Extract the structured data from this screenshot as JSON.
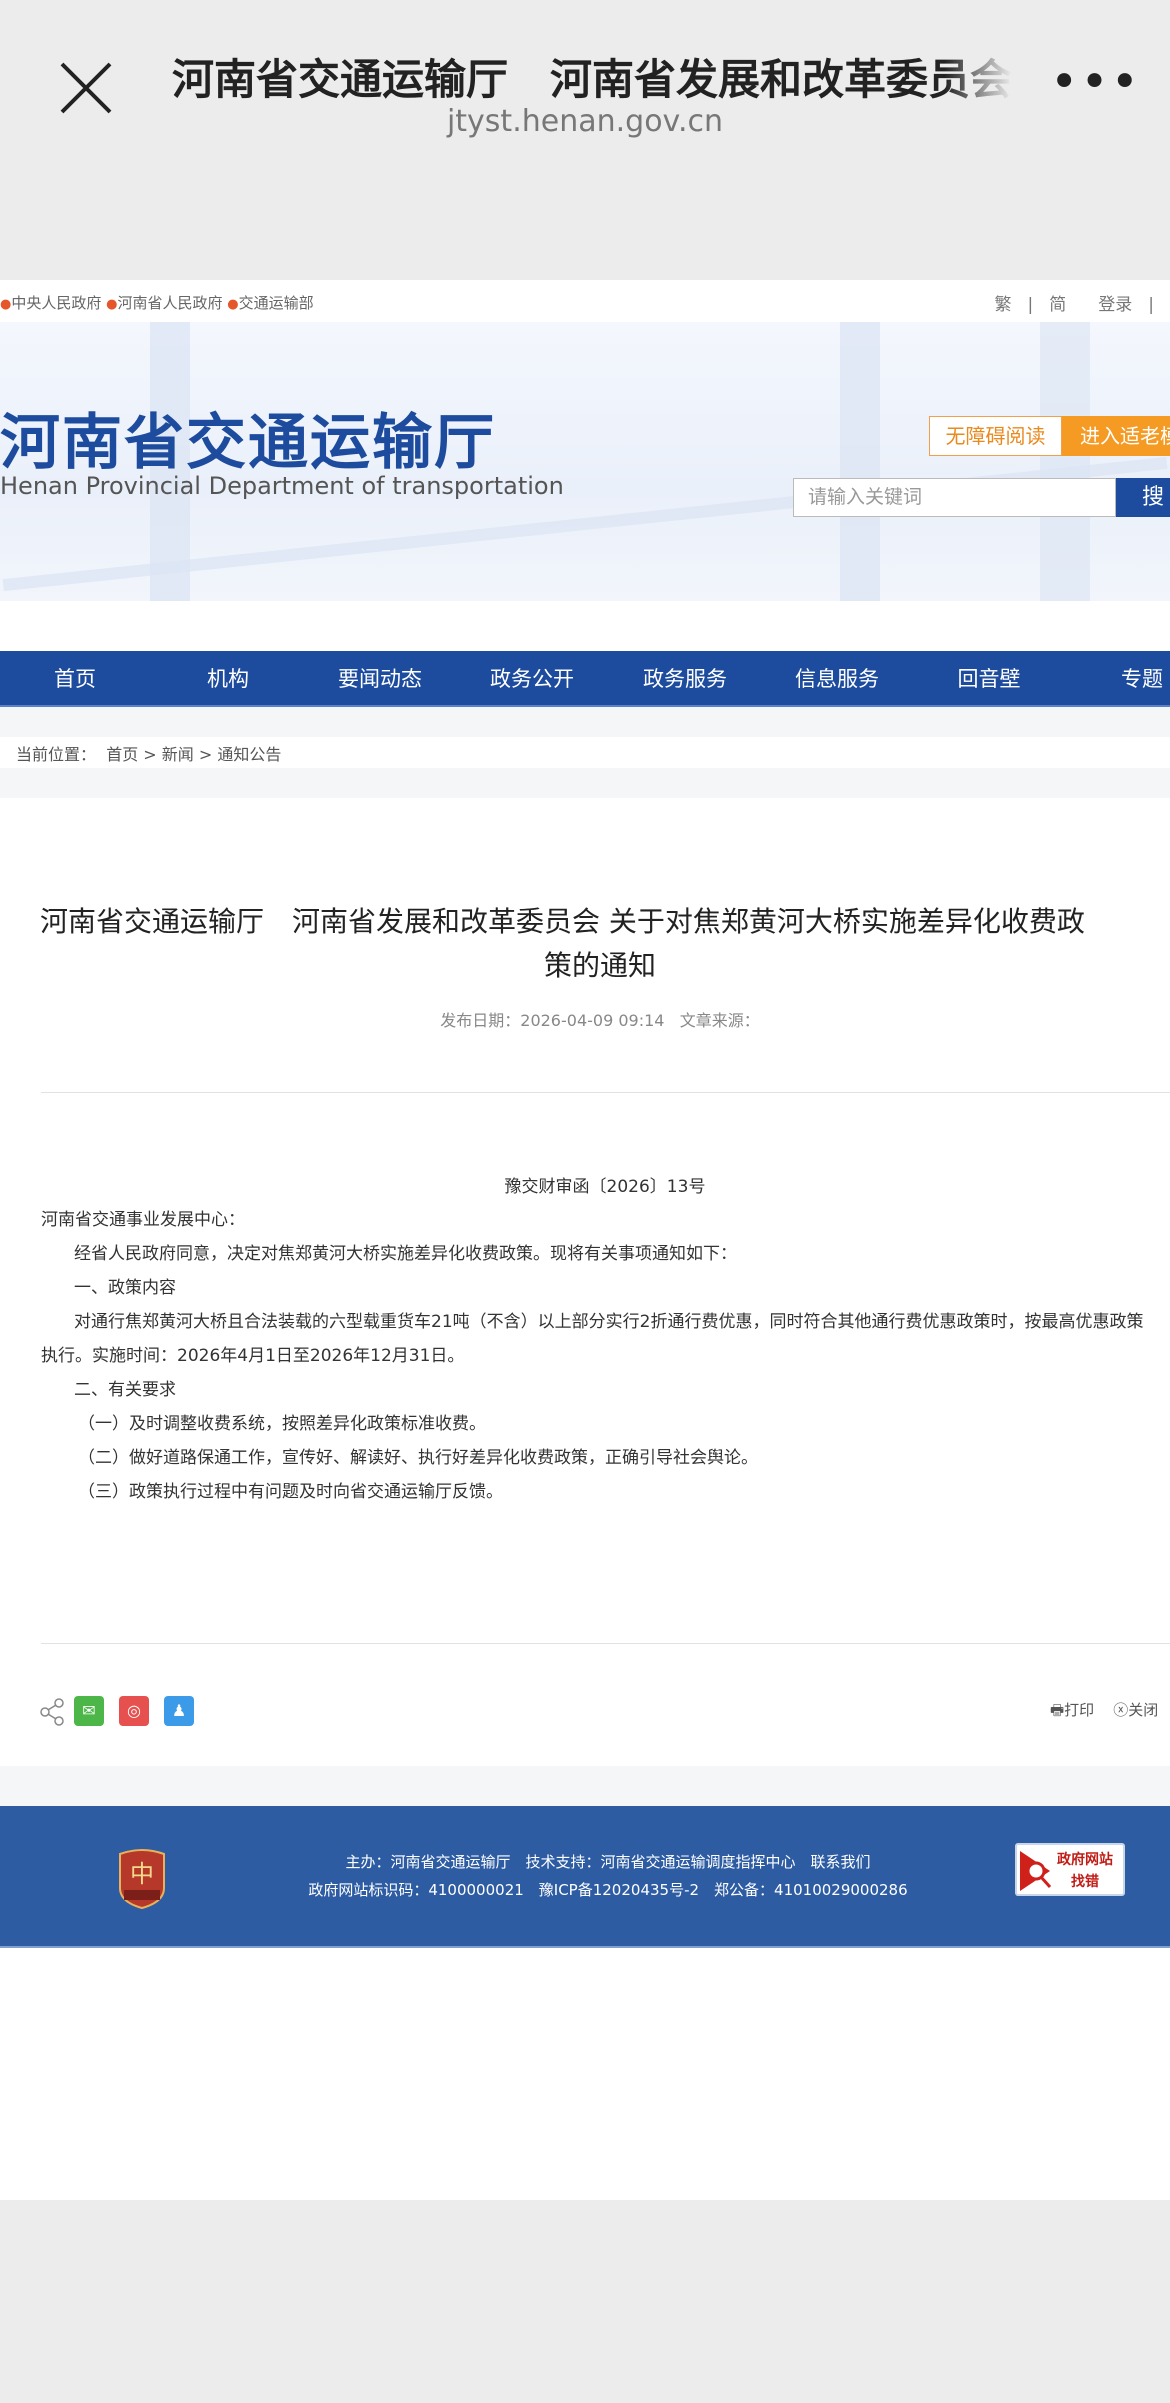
{
  "app_bar": {
    "title": "河南省交通运输厅　河南省发展和改革委员会 关于对焦郑黄河大桥实施差异化收费政策的通知",
    "url": "jtyst.henan.gov.cn",
    "more": "•••"
  },
  "top_links": [
    "中央人民政府",
    "河南省人民政府",
    "交通运输部"
  ],
  "right_links": {
    "traditional": "繁",
    "simplified": "简",
    "login": "登录",
    "sep": "|"
  },
  "banner": {
    "logo_cn": "河南省交通运输厅",
    "logo_en": "Henan Provincial Department of transportation",
    "accessible": "无障碍阅读",
    "elder": "进入适老模式",
    "search_placeholder": "请输入关键词",
    "search_btn": "搜"
  },
  "nav": [
    "首页",
    "机构",
    "要闻动态",
    "政务公开",
    "政务服务",
    "信息服务",
    "回音壁",
    "专题"
  ],
  "breadcrumb": {
    "label": "当前位置：",
    "items": [
      "首页",
      "新闻",
      "通知公告"
    ],
    "sep": ">"
  },
  "article": {
    "title_line1": "河南省交通运输厅　河南省发展和改革委员会 关于对焦郑黄河大桥实施差异化收费政",
    "title_line2": "策的通知",
    "date_label": "发布日期：",
    "date": "2026-04-09 09:14",
    "source_label": "文章来源：",
    "doc_no": "豫交财审函〔2026〕13号",
    "paragraphs": [
      "河南省交通事业发展中心：",
      "经省人民政府同意，决定对焦郑黄河大桥实施差异化收费政策。现将有关事项通知如下：",
      "一、政策内容",
      "对通行焦郑黄河大桥且合法装载的六型载重货车21吨（不含）以上部分实行2折通行费优惠，同时符合其他通行费优惠政策时，按最高优惠政策",
      "执行。实施时间：2026年4月1日至2026年12月31日。",
      "二、有关要求",
      "（一）及时调整收费系统，按照差异化政策标准收费。",
      "（二）做好道路保通工作，宣传好、解读好、执行好差异化收费政策，正确引导社会舆论。",
      "（三）政策执行过程中有问题及时向省交通运输厅反馈。"
    ]
  },
  "actions": {
    "print": "打印",
    "close": "关闭"
  },
  "share_icons": [
    "share-icon",
    "wechat-icon",
    "weibo-icon",
    "qq-icon"
  ],
  "footer": {
    "line1": "主办：河南省交通运输厅　技术支持：河南省交通运输调度指挥中心　联系我们",
    "line2": "政府网站标识码：4100000021　豫ICP备12020435号-2　郑公备：41010029000286",
    "emblem_text": "党政机关",
    "jiucuo_line1": "政府网站",
    "jiucuo_line2": "找错"
  },
  "colors": {
    "nav_blue": "#1d4c9e",
    "footer_blue": "#2d5ca3",
    "orange": "#f59a23"
  }
}
